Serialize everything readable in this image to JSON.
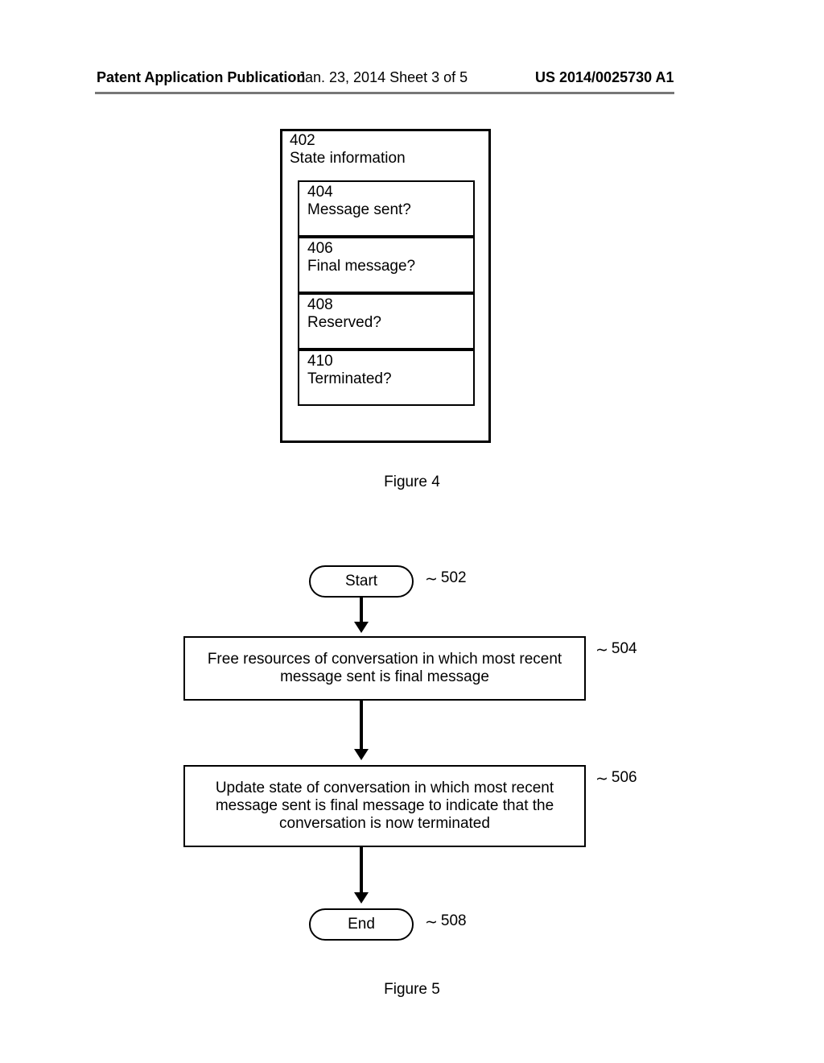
{
  "header": {
    "left": "Patent Application Publication",
    "mid": "Jan. 23, 2014  Sheet 3 of 5",
    "right": "US 2014/0025730 A1"
  },
  "fig4": {
    "outer_num": "402",
    "outer_label": "State information",
    "rows": [
      {
        "num": "404",
        "label": "Message sent?"
      },
      {
        "num": "406",
        "label": "Final message?"
      },
      {
        "num": "408",
        "label": "Reserved?"
      },
      {
        "num": "410",
        "label": "Terminated?"
      }
    ],
    "caption": "Figure 4"
  },
  "fig5": {
    "start_label": "Start",
    "start_ref": "502",
    "proc1_text": "Free resources of conversation in which most recent message sent is final message",
    "proc1_ref": "504",
    "proc2_text": "Update state of conversation in which most recent message sent is final message to indicate that the conversation is now terminated",
    "proc2_ref": "506",
    "end_label": "End",
    "end_ref": "508",
    "caption": "Figure 5"
  }
}
